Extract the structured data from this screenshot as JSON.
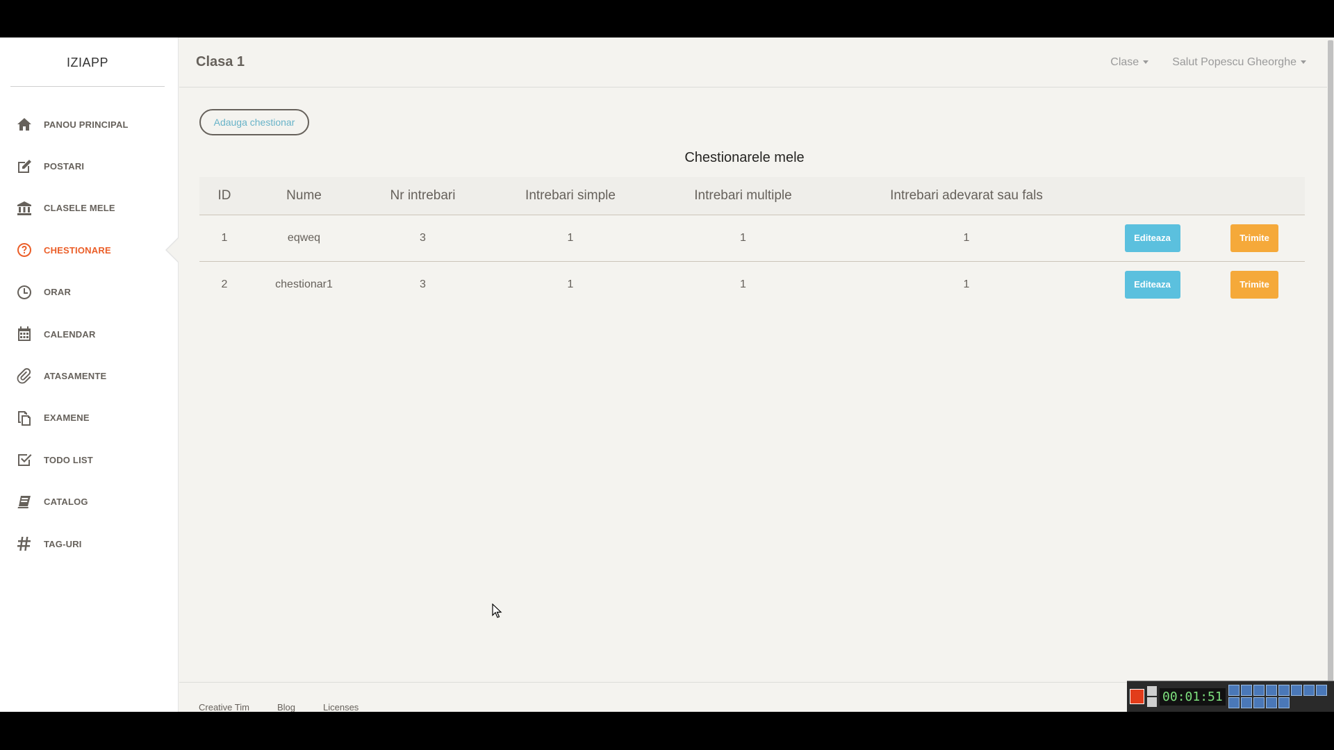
{
  "brand": "IZIAPP",
  "sidebar": {
    "items": [
      {
        "label": "PANOU PRINCIPAL",
        "icon": "home-icon",
        "active": false
      },
      {
        "label": "POSTARI",
        "icon": "edit-icon",
        "active": false
      },
      {
        "label": "CLASELE MELE",
        "icon": "bank-icon",
        "active": false
      },
      {
        "label": "CHESTIONARE",
        "icon": "question-circle-icon",
        "active": true
      },
      {
        "label": "ORAR",
        "icon": "clock-icon",
        "active": false
      },
      {
        "label": "CALENDAR",
        "icon": "calendar-icon",
        "active": false
      },
      {
        "label": "ATASAMENTE",
        "icon": "paperclip-icon",
        "active": false
      },
      {
        "label": "EXAMENE",
        "icon": "files-icon",
        "active": false
      },
      {
        "label": "TODO LIST",
        "icon": "checkbox-icon",
        "active": false
      },
      {
        "label": "CATALOG",
        "icon": "book-icon",
        "active": false
      },
      {
        "label": "TAG-URI",
        "icon": "hashtag-icon",
        "active": false
      }
    ]
  },
  "header": {
    "title": "Clasa 1",
    "classes_menu": "Clase",
    "user_menu": "Salut Popescu Gheorghe"
  },
  "main": {
    "add_button": "Adauga chestionar",
    "table_title": "Chestionarele mele",
    "columns": [
      "ID",
      "Nume",
      "Nr intrebari",
      "Intrebari simple",
      "Intrebari multiple",
      "Intrebari adevarat sau fals"
    ],
    "rows": [
      {
        "id": "1",
        "name": "eqweq",
        "total": "3",
        "simple": "1",
        "multiple": "1",
        "truefalse": "1"
      },
      {
        "id": "2",
        "name": "chestionar1",
        "total": "3",
        "simple": "1",
        "multiple": "1",
        "truefalse": "1"
      }
    ],
    "edit_label": "Editeaza",
    "send_label": "Trimite"
  },
  "footer": {
    "links": [
      "Creative Tim",
      "Blog",
      "Licenses"
    ]
  },
  "tray": {
    "timer": "00:01:51"
  },
  "colors": {
    "accent": "#eb5e28",
    "edit": "#5bc0de",
    "send": "#f5a93a",
    "background": "#f4f3ef"
  }
}
